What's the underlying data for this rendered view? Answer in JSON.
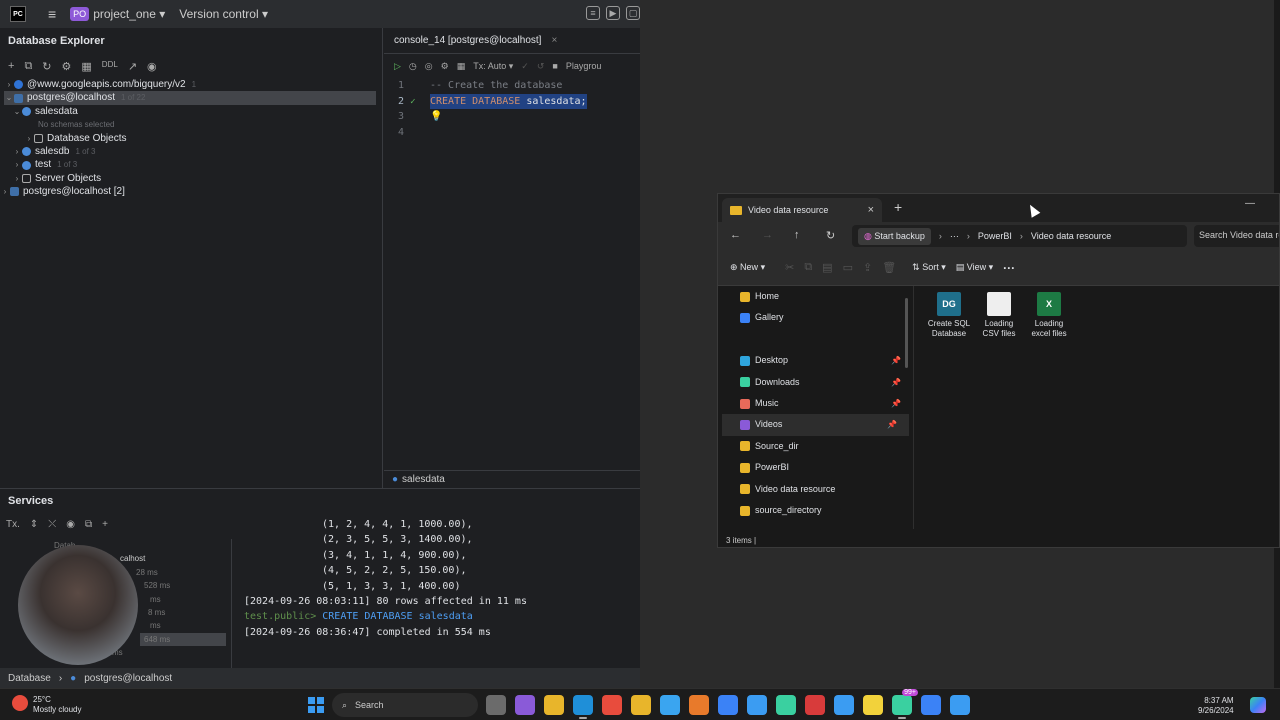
{
  "ide": {
    "project_badge": "PO",
    "project_name": "project_one",
    "version_control": "Version control",
    "db_explorer": {
      "title": "Database Explorer",
      "toolbar_ddl": "DDL",
      "tree": [
        {
          "label": "@www.googleapis.com/bigquery/v2",
          "count": "1"
        },
        {
          "label": "postgres@localhost",
          "count": "1 of 22"
        },
        {
          "label": "salesdata"
        },
        {
          "label": "No schemas selected"
        },
        {
          "label": "Database Objects"
        },
        {
          "label": "salesdb",
          "count": "1 of 3"
        },
        {
          "label": "test",
          "count": "1 of 3"
        },
        {
          "label": "Server Objects"
        },
        {
          "label": "postgres@localhost [2]"
        }
      ]
    },
    "editor": {
      "tab_label": "console_14 [postgres@localhost]",
      "tx_label": "Tx: Auto",
      "playground": "Playgrou",
      "lines": [
        "1",
        "2",
        "3",
        "4"
      ],
      "comment": "-- Create the database",
      "sql_kw": "CREATE DATABASE",
      "sql_name": " salesdata;",
      "footer": "salesdata"
    },
    "services": {
      "title": "Services",
      "tx": "Tx.",
      "tree": [
        "Datab",
        "calhost",
        "28 ms",
        "528 ms",
        "ms",
        "8 ms",
        "ms",
        "648 ms",
        "ms"
      ],
      "console": [
        "(1, 2, 4, 4, 1, 1000.00),",
        "(2, 3, 5, 5, 3, 1400.00),",
        "(3, 4, 1, 1, 4, 900.00),",
        "(4, 5, 2, 2, 5, 150.00),",
        "(5, 1, 3, 3, 1, 400.00)",
        "[2024-09-26 08:03:11] 80 rows affected in 11 ms"
      ],
      "prompt": "test.public>",
      "cmd": " CREATE DATABASE salesdata",
      "last": "[2024-09-26 08:36:47] completed in 554 ms"
    },
    "statusbar": {
      "left": "Database",
      "right": "postgres@localhost"
    }
  },
  "explorer": {
    "tab_title": "Video data resource",
    "crumb_backup": "Start backup",
    "crumb_more": "···",
    "crumb_powerbi": "PowerBI",
    "crumb_current": "Video data resource",
    "search_placeholder": "Search Video data re",
    "new_label": "New",
    "sort_label": "Sort",
    "view_label": "View",
    "more_label": "···",
    "sidebar": [
      {
        "label": "Home",
        "color": "#e8b52b"
      },
      {
        "label": "Gallery",
        "color": "#3b82f6"
      },
      {
        "label": "",
        "color": ""
      },
      {
        "label": "Desktop",
        "color": "#2fa5dd",
        "pinned": true
      },
      {
        "label": "Downloads",
        "color": "#3ad0a0",
        "pinned": true
      },
      {
        "label": "Music",
        "color": "#e86a5a",
        "pinned": true
      },
      {
        "label": "Videos",
        "color": "#8a5ad8",
        "pinned": true
      },
      {
        "label": "Source_dir",
        "color": "#e8b52b"
      },
      {
        "label": "PowerBI",
        "color": "#e8b52b"
      },
      {
        "label": "Video data resource",
        "color": "#e8b52b"
      },
      {
        "label": "source_directory",
        "color": "#e8b52b"
      }
    ],
    "files": [
      {
        "line1": "Create SQL",
        "line2": "Database",
        "color": "#1f6f8b",
        "icon_label": "DG"
      },
      {
        "line1": "Loading",
        "line2": "CSV files",
        "color": "#eeeeee",
        "icon_label": ""
      },
      {
        "line1": "Loading",
        "line2": "excel files",
        "color": "#1d7a44",
        "icon_label": "X"
      }
    ],
    "status": "3 items  |"
  },
  "taskbar": {
    "temp": "25°C",
    "weather": "Mostly cloudy",
    "search": "Search",
    "time": "8:37 AM",
    "date": "9/26/2024",
    "badge": "99+",
    "apps": [
      "#6b6b6b",
      "#8a5ad8",
      "#e8b52b",
      "#1f8fd8",
      "#e84c3d",
      "#e8b52b",
      "#3aa5f0",
      "#e87a2b",
      "#3b82f6",
      "#3b9cf2",
      "#3ad0a0",
      "#d83b3b",
      "#3b9cf2",
      "#f2d23b",
      "#3ad0a0",
      "#3b82f6",
      "#3b9cf2"
    ]
  }
}
